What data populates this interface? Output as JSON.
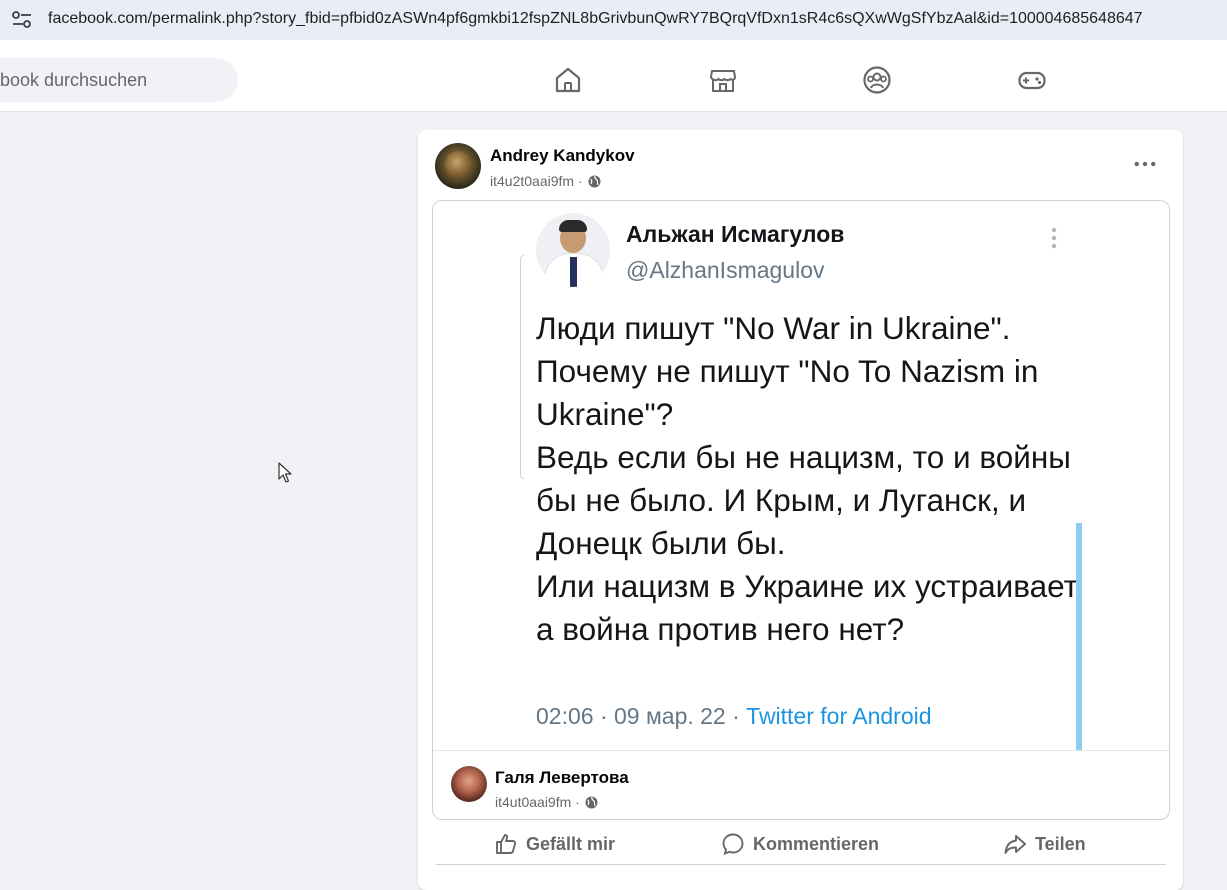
{
  "browser": {
    "url": "facebook.com/permalink.php?story_fbid=pfbid0zASWn4pf6gmkbi12fspZNL8bGrivbunQwRY7BQrqVfDxn1sR4c6sQXwWgSfYbzAal&id=100004685648647"
  },
  "nav": {
    "search_placeholder": "book durchsuchen",
    "icons": [
      "home-icon",
      "marketplace-icon",
      "groups-icon",
      "gaming-icon"
    ]
  },
  "post": {
    "author": "Andrey Kandykov",
    "meta": "it4u2t0aai9fm ·",
    "tweet": {
      "name": "Альжан Исмагулов",
      "handle": "@AlzhanIsmagulov",
      "text": "Люди пишут \"No War in Ukraine\".\nПочему не пишут \"No To Nazism in Ukraine\"?\nВедь если бы не нацизм, то и войны бы не было. И Крым, и Луганск, и Донецк были бы.\nИли нацизм в Украине их устраивает, а война против него нет?",
      "time": "02:06 · 09 мар. 22 · ",
      "source": "Twitter for Android"
    },
    "shared_by": {
      "name": "Галя Левертова",
      "meta": "it4ut0aai9fm ·"
    },
    "actions": {
      "like": "Gefällt mir",
      "comment": "Kommentieren",
      "share": "Teilen"
    }
  },
  "colors": {
    "fb_bg": "#f0f2f5",
    "tweet_link": "#1b95e0",
    "secondary_text": "#65676b"
  }
}
